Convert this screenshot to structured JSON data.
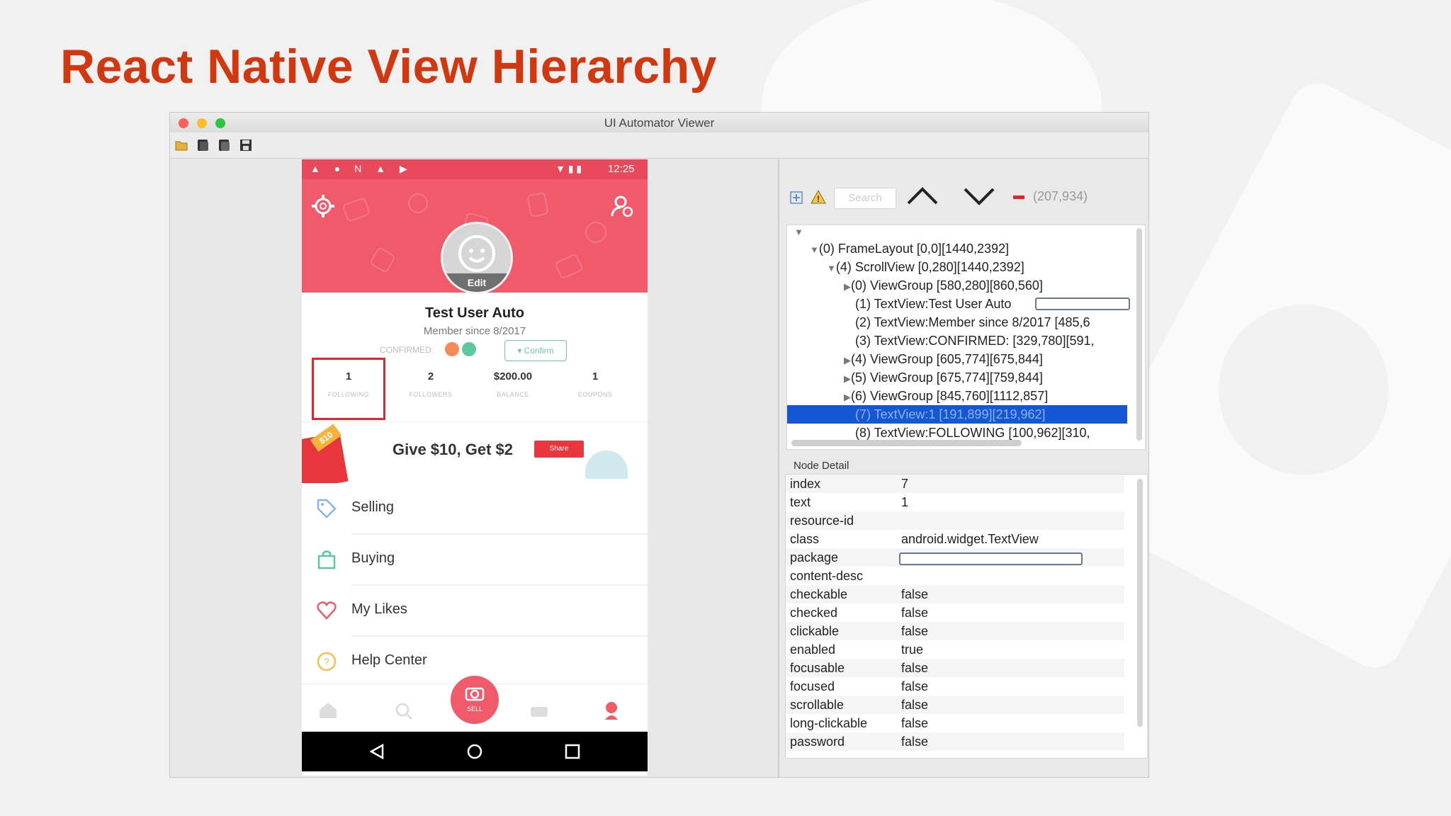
{
  "slide": {
    "title": "React Native View Hierarchy"
  },
  "window": {
    "title": "UI Automator Viewer"
  },
  "phone": {
    "status_time": "12:25",
    "header": {
      "edit_label": "Edit"
    },
    "user_name": "Test User Auto",
    "member_since": "Member since 8/2017",
    "confirmed_label": "CONFIRMED:",
    "confirm_button": "Confirm",
    "stats": [
      {
        "value": "1",
        "label": "FOLLOWING"
      },
      {
        "value": "2",
        "label": "FOLLOWERS"
      },
      {
        "value": "$200.00",
        "label": "BALANCE"
      },
      {
        "value": "1",
        "label": "COUPONS"
      }
    ],
    "banner": {
      "text": "Give $10, Get $2",
      "button": "Share",
      "tag": "$10"
    },
    "menu": [
      {
        "label": "Selling",
        "icon": "tag-icon"
      },
      {
        "label": "Buying",
        "icon": "shopping-bag-icon"
      },
      {
        "label": "My Likes",
        "icon": "heart-icon"
      },
      {
        "label": "Help Center",
        "icon": "help-icon"
      }
    ],
    "bottom_nav": {
      "sell_label": "SELL"
    }
  },
  "viewer": {
    "search_placeholder": "Search",
    "coordinates": "(207,934)",
    "tree": [
      "(0) FrameLayout [0,0][1440,2392]",
      "(4) ScrollView [0,280][1440,2392]",
      "(0) ViewGroup [580,280][860,560]",
      "(1) TextView:Test User Auto",
      "(2) TextView:Member since 8/2017 [485,6",
      "(3) TextView:CONFIRMED: [329,780][591,",
      "(4) ViewGroup [605,774][675,844]",
      "(5) ViewGroup [675,774][759,844]",
      "(6) ViewGroup [845,760][1112,857]",
      "(7) TextView:1 [191,899][219,962]",
      "(8) TextView:FOLLOWING [100,962][310,"
    ],
    "node_detail_label": "Node Detail",
    "node_detail": [
      {
        "key": "index",
        "value": "7"
      },
      {
        "key": "text",
        "value": "1"
      },
      {
        "key": "resource-id",
        "value": ""
      },
      {
        "key": "class",
        "value": "android.widget.TextView"
      },
      {
        "key": "package",
        "value": ""
      },
      {
        "key": "content-desc",
        "value": ""
      },
      {
        "key": "checkable",
        "value": "false"
      },
      {
        "key": "checked",
        "value": "false"
      },
      {
        "key": "clickable",
        "value": "false"
      },
      {
        "key": "enabled",
        "value": "true"
      },
      {
        "key": "focusable",
        "value": "false"
      },
      {
        "key": "focused",
        "value": "false"
      },
      {
        "key": "scrollable",
        "value": "false"
      },
      {
        "key": "long-clickable",
        "value": "false"
      },
      {
        "key": "password",
        "value": "false"
      }
    ]
  },
  "colors": {
    "title": "#d2380f",
    "brand": "#f05a6b",
    "selection": "#1357d2",
    "highlight_box": "#e3262b"
  }
}
